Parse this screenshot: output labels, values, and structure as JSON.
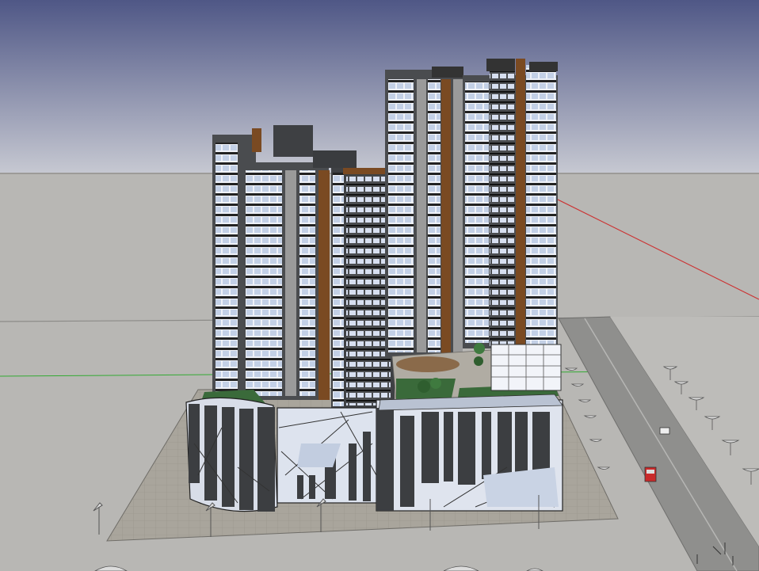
{
  "scene": {
    "kind": "3d-architectural-model-viewport",
    "colors": {
      "sky_top": "#4f5786",
      "sky_bottom": "#c7c9d2",
      "ground": "#b8b7b4",
      "plaza": "#a7a39a",
      "road": "#8f8f8d",
      "tower_dark": "#4a4c4f",
      "tower_white": "#f3f5fb",
      "glass": "#c9d7ee",
      "wood_accent": "#7a4a22",
      "greenery": "#3a6a3a",
      "axis_red": "#cc3333",
      "axis_green": "#33aa33"
    },
    "elements": {
      "towers": [
        "left-tower",
        "center-tower",
        "right-tower-a",
        "right-tower-b"
      ],
      "podium": [
        "curved-podium-left",
        "podium-front-block",
        "podium-right-block"
      ],
      "site": [
        "paved-plaza",
        "street",
        "street-lamps",
        "parked-cars",
        "roof-garden"
      ]
    }
  }
}
